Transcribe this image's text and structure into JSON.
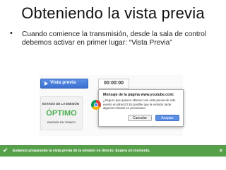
{
  "slide": {
    "title": "Obteniendo la vista previa",
    "bullet_text": "Cuando comience la transmisión, desde la sala de control debemos activar en primer lugar: “Vista Previa”"
  },
  "toolbar": {
    "preview_label": "Vista previa",
    "timer": "00:00:00"
  },
  "status_panel": {
    "header": "ESTADO DE LA EMISIÓN",
    "status": "ÓPTIMO",
    "subtext": "EMISIÓN EN TIEMPO"
  },
  "dialog": {
    "title": "Mensaje de la página www.youtube.com:",
    "body": "¿Seguro que quieres obtener una vista previa de este evento en directo? Es posible que la emisión tarde algunos minutos en procesarse.",
    "cancel_label": "Cancelar",
    "accept_label": "Aceptar"
  },
  "notification": {
    "text": "Estamos preparando la vista previa de la emisión en directo. Espera un momento."
  },
  "icons": {
    "bullet": "bullet-icon",
    "play": "play-icon",
    "browser": "chrome-icon",
    "check": "check-icon",
    "close": "close-icon"
  },
  "colors": {
    "primary_blue": "#3a6fd0",
    "status_green": "#4caf50",
    "notification_green": "#56a04a"
  }
}
